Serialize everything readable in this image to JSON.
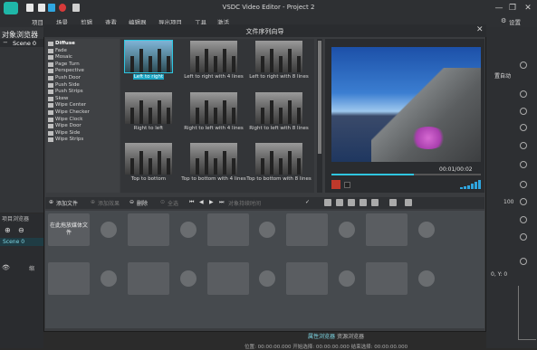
{
  "window": {
    "title": "VSDC Video Editor - Project 2",
    "minimize": "—",
    "maximize": "❐",
    "close": "✕"
  },
  "menu": [
    "项目",
    "场景",
    "剪辑",
    "查看",
    "编辑器",
    "导出项目",
    "工具",
    "激活"
  ],
  "settings_label": "设置",
  "object_panel": {
    "title": "对象浏览器",
    "scene": "Scene 0"
  },
  "lower_left": {
    "tabs": [
      "项目浏览器",
      "对象"
    ],
    "scene": "Scene 0",
    "extra": "缩"
  },
  "right_panel": {
    "label": "置自动",
    "numbers": [
      "100",
      "0, Y: 0"
    ]
  },
  "dialog": {
    "title": "文件序列向导",
    "effects": [
      "Diffuse",
      "Fade",
      "Mosaic",
      "Page Turn",
      "Perspective",
      "Push Door",
      "Push Side",
      "Push Strips",
      "Skew",
      "Wipe Center",
      "Wipe Checker",
      "Wipe Clock",
      "Wipe Door",
      "Wipe Side",
      "Wipe Strips"
    ],
    "thumbnails": [
      "Left to right",
      "Left to right with 4 lines",
      "Left to right with 8 lines",
      "Right to left",
      "Right to left with 4 lines",
      "Right to left with 8 lines",
      "Top to bottom",
      "Top to bottom with 4 lines",
      "Top to bottom with 8 lines"
    ],
    "preview": {
      "time": "00:01/00:02",
      "progress": 0.55
    },
    "toolbar": {
      "add_file": "添加文件",
      "add_effect": "添加效果",
      "delete": "删除",
      "all": "全选",
      "duration": "对象持续时间"
    },
    "storyboard": {
      "drop_text": "在此拖放媒体文件"
    }
  },
  "bottom": {
    "tabs": [
      "属性浏览器",
      "资源浏览器"
    ],
    "coords": "位置: 00:00:00.000 开始选择: 00:00:00.000 结束选择: 00:00:00.000"
  }
}
